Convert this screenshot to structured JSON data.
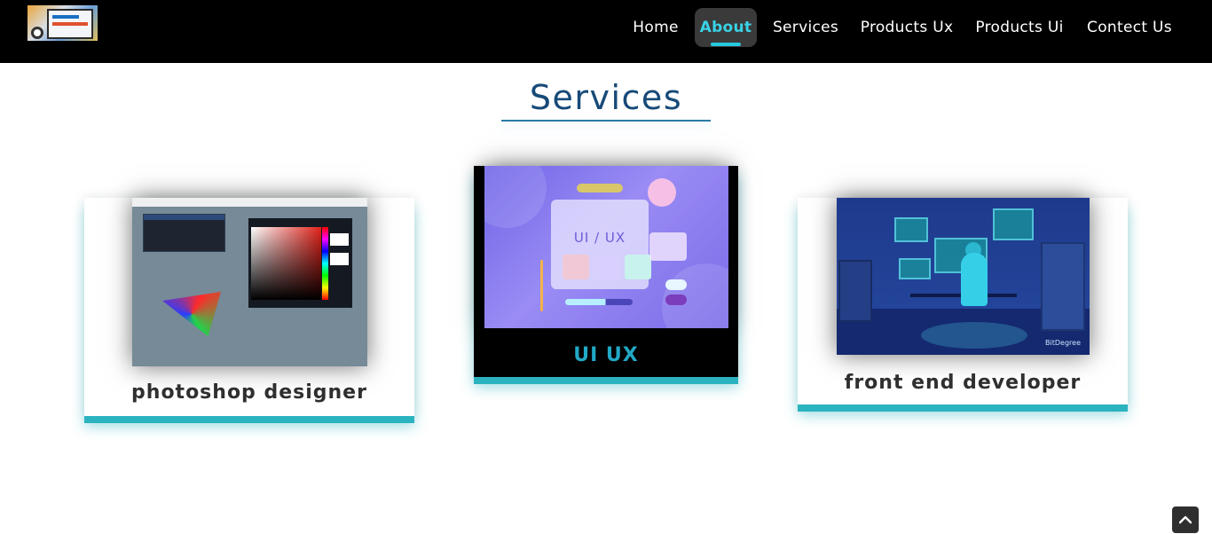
{
  "nav": {
    "logo_alt": "Front End Developer",
    "items": [
      {
        "label": "Home",
        "active": false
      },
      {
        "label": "About",
        "active": true
      },
      {
        "label": "Services",
        "active": false
      },
      {
        "label": "Products Ux",
        "active": false
      },
      {
        "label": "Products Ui",
        "active": false
      },
      {
        "label": "Contect Us",
        "active": false
      }
    ]
  },
  "section": {
    "title": "Services"
  },
  "cards": [
    {
      "label": "photoshop designer",
      "image": "photoshop-screenshot"
    },
    {
      "label": "UI UX",
      "image": "ui-ux-illustration",
      "image_text": "UI / UX"
    },
    {
      "label": "front end developer",
      "image": "front-end-developer-illustration",
      "image_brand": "BitDegree"
    }
  ],
  "scroll_top": {
    "icon": "chevron-up-icon"
  },
  "colors": {
    "nav_bg": "#000000",
    "nav_active_text": "#3ad2e6",
    "title": "#174a78",
    "card_shadow": "#2bb3c0",
    "uiux_label": "#22a8c6"
  }
}
